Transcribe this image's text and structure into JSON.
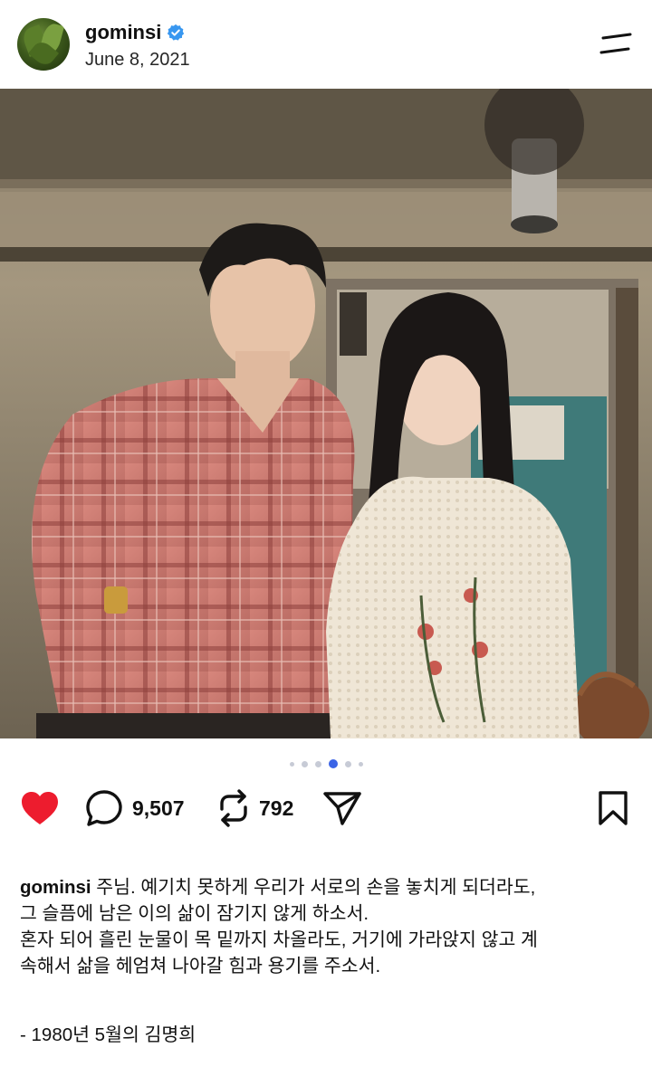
{
  "post": {
    "username": "gominsi",
    "date": "June 8, 2021",
    "carousel": {
      "total": 6,
      "active": 3
    }
  },
  "actions": {
    "comments": "9,507",
    "reposts": "792"
  },
  "icons": {
    "like": "heart-icon",
    "comment": "comment-bubble-icon",
    "repost": "repost-icon",
    "share": "send-icon",
    "save": "bookmark-icon",
    "menu": "menu-icon",
    "verified": "verified-badge-icon"
  },
  "colors": {
    "like": "#ed1c2e",
    "verified": "#3897f0",
    "carousel_active": "#3b64e6"
  },
  "caption": {
    "user": "gominsi",
    "line1": " 주님. 예기치 못하게 우리가 서로의 손을 놓치게 되더라도,",
    "line2": "그 슬픔에 남은 이의 삶이 잠기지 않게 하소서.",
    "line3": "혼자 되어 흘린 눈물이 목 밑까지 차올라도, 거기에 가라앉지 않고 계",
    "line4": "속해서 삶을 헤엄쳐 나아갈 힘과 용기를 주소서.",
    "signature": "- 1980년 5월의 김명희"
  }
}
